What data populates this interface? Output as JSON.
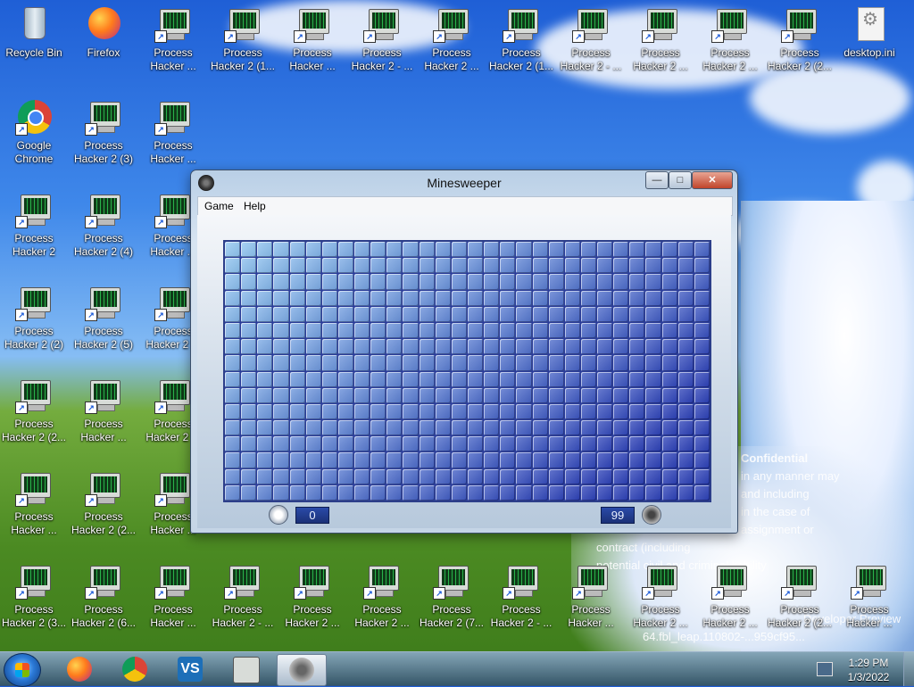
{
  "desktop": {
    "icons": [
      {
        "label": "Recycle Bin",
        "line2": "",
        "kind": "recycle-bin"
      },
      {
        "label": "Firefox",
        "line2": "",
        "kind": "firefox"
      },
      {
        "label": "Process",
        "line2": "Hacker ...",
        "kind": "process-hacker"
      },
      {
        "label": "Process",
        "line2": "Hacker 2 (1...",
        "kind": "process-hacker"
      },
      {
        "label": "Process",
        "line2": "Hacker ...",
        "kind": "process-hacker"
      },
      {
        "label": "Process",
        "line2": "Hacker 2 - ...",
        "kind": "process-hacker"
      },
      {
        "label": "Process",
        "line2": "Hacker 2 ...",
        "kind": "process-hacker"
      },
      {
        "label": "Process",
        "line2": "Hacker 2 (1...",
        "kind": "process-hacker"
      },
      {
        "label": "Process",
        "line2": "Hacker 2 - ...",
        "kind": "process-hacker"
      },
      {
        "label": "Process",
        "line2": "Hacker 2 ...",
        "kind": "process-hacker"
      },
      {
        "label": "Process",
        "line2": "Hacker 2 ...",
        "kind": "process-hacker"
      },
      {
        "label": "Process",
        "line2": "Hacker 2 (2...",
        "kind": "process-hacker"
      },
      {
        "label": "desktop.ini",
        "line2": "",
        "kind": "settings-file"
      },
      {
        "label": "Google",
        "line2": "Chrome",
        "kind": "chrome"
      },
      {
        "label": "Process",
        "line2": "Hacker 2 (3)",
        "kind": "process-hacker"
      },
      {
        "label": "Process",
        "line2": "Hacker ...",
        "kind": "process-hacker"
      },
      {
        "label": "Process",
        "line2": "Hacker 2",
        "kind": "process-hacker"
      },
      {
        "label": "Process",
        "line2": "Hacker 2 (4)",
        "kind": "process-hacker"
      },
      {
        "label": "Process",
        "line2": "Hacker ...",
        "kind": "process-hacker"
      },
      {
        "label": "Process",
        "line2": "Hacker 2 (2)",
        "kind": "process-hacker"
      },
      {
        "label": "Process",
        "line2": "Hacker 2 (5)",
        "kind": "process-hacker"
      },
      {
        "label": "Process",
        "line2": "Hacker 2 ...",
        "kind": "process-hacker"
      },
      {
        "label": "Process",
        "line2": "Hacker 2 (2...",
        "kind": "process-hacker"
      },
      {
        "label": "Process",
        "line2": "Hacker ...",
        "kind": "process-hacker"
      },
      {
        "label": "Process",
        "line2": "Hacker 2 ...",
        "kind": "process-hacker"
      },
      {
        "label": "Process",
        "line2": "Hacker ...",
        "kind": "process-hacker"
      },
      {
        "label": "Process",
        "line2": "Hacker 2 (2...",
        "kind": "process-hacker"
      },
      {
        "label": "Process",
        "line2": "Hacker ...",
        "kind": "process-hacker"
      },
      {
        "label": "Process",
        "line2": "Hacker 2 (3...",
        "kind": "process-hacker"
      },
      {
        "label": "Process",
        "line2": "Hacker 2 (6...",
        "kind": "process-hacker"
      },
      {
        "label": "Process",
        "line2": "Hacker ...",
        "kind": "process-hacker"
      },
      {
        "label": "Process",
        "line2": "Hacker 2 - ...",
        "kind": "process-hacker"
      },
      {
        "label": "Process",
        "line2": "Hacker 2 ...",
        "kind": "process-hacker"
      },
      {
        "label": "Process",
        "line2": "Hacker 2 ...",
        "kind": "process-hacker"
      },
      {
        "label": "Process",
        "line2": "Hacker 2 (7...",
        "kind": "process-hacker"
      },
      {
        "label": "Process",
        "line2": "Hacker 2 - ...",
        "kind": "process-hacker"
      },
      {
        "label": "Process",
        "line2": "Hacker ...",
        "kind": "process-hacker"
      },
      {
        "label": "Process",
        "line2": "Hacker 2 ...",
        "kind": "process-hacker"
      },
      {
        "label": "Process",
        "line2": "Hacker 2 ...",
        "kind": "process-hacker"
      },
      {
        "label": "Process",
        "line2": "Hacker 2 (2...",
        "kind": "process-hacker"
      },
      {
        "label": "Process",
        "line2": "Hacker ...",
        "kind": "process-hacker"
      }
    ],
    "watermark": {
      "title": "Confidential",
      "lines": [
        "in any manner may",
        "and including",
        "in the case of",
        "assignment or",
        "contract (including",
        "potential civil and criminal liability"
      ],
      "build": "Developer Preview",
      "build2": "64.fbl_leap.110802-...959cf95..."
    }
  },
  "window": {
    "title": "Minesweeper",
    "menu": [
      "Game",
      "Help"
    ],
    "timer": "0",
    "mines_remaining": "99",
    "grid": {
      "columns": 30,
      "rows": 16
    },
    "controls": {
      "minimize": "—",
      "maximize": "□",
      "close": "✕"
    }
  },
  "taskbar": {
    "apps": [
      "firefox",
      "chrome",
      "visual-studio",
      "process-hacker",
      "minesweeper"
    ],
    "active_app": "minesweeper",
    "vs_glyph": "VS",
    "clock_time": "1:29 PM",
    "clock_date": "1/3/2022"
  },
  "colors": {
    "grid_light": "#8fc6f2",
    "grid_dark": "#2a3fb8",
    "grid_border": "#2c3e8a"
  }
}
